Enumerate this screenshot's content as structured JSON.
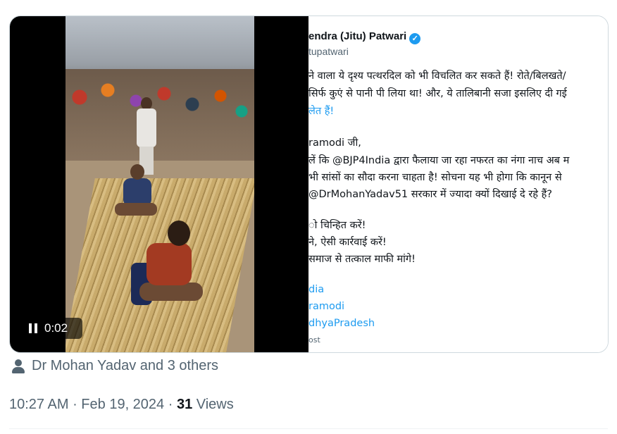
{
  "video": {
    "time": "0:02",
    "pause_icon": "pause-icon"
  },
  "embedded_tweet": {
    "name": "endra (Jitu) Patwari",
    "handle": "tupatwari",
    "lines": [
      "ने वाला ये दृश्य पत्थरदिल को भी विचलित कर सकते हैं! रोते/बिलखते/",
      " सिर्फ कुएं से पानी पी लिया था! और, ये तालिबानी सजा इसलिए दी गई",
      "लेत हैं!",
      "ramodi जी,",
      "लें कि @BJP4India द्वारा फैलाया जा रहा नफरत का नंगा नाच अब म",
      " भी सांसों का सौदा करना चाहता है! सोचना यह भी होगा कि कानून से",
      "@DrMohanYadav51 सरकार में ज्यादा क्यों दिखाई दे रहे हैं?",
      "ो चिन्हित करें!",
      "ने, ऐसी कार्रवाई करें!",
      " समाज से तत्काल माफी मांगे!",
      "dia",
      "ramodi",
      "dhyaPradesh",
      "ost"
    ]
  },
  "liked_by": {
    "icon": "person-icon",
    "text": "Dr Mohan Yadav and 3 others"
  },
  "meta": {
    "time": "10:27 AM",
    "sep1": " · ",
    "date": "Feb 19, 2024",
    "sep2": " · ",
    "views_count": "31",
    "views_label": " Views"
  },
  "colors": {
    "accent": "#1d9bf0",
    "secondary_text": "#536471",
    "primary_text": "#0f1419"
  }
}
